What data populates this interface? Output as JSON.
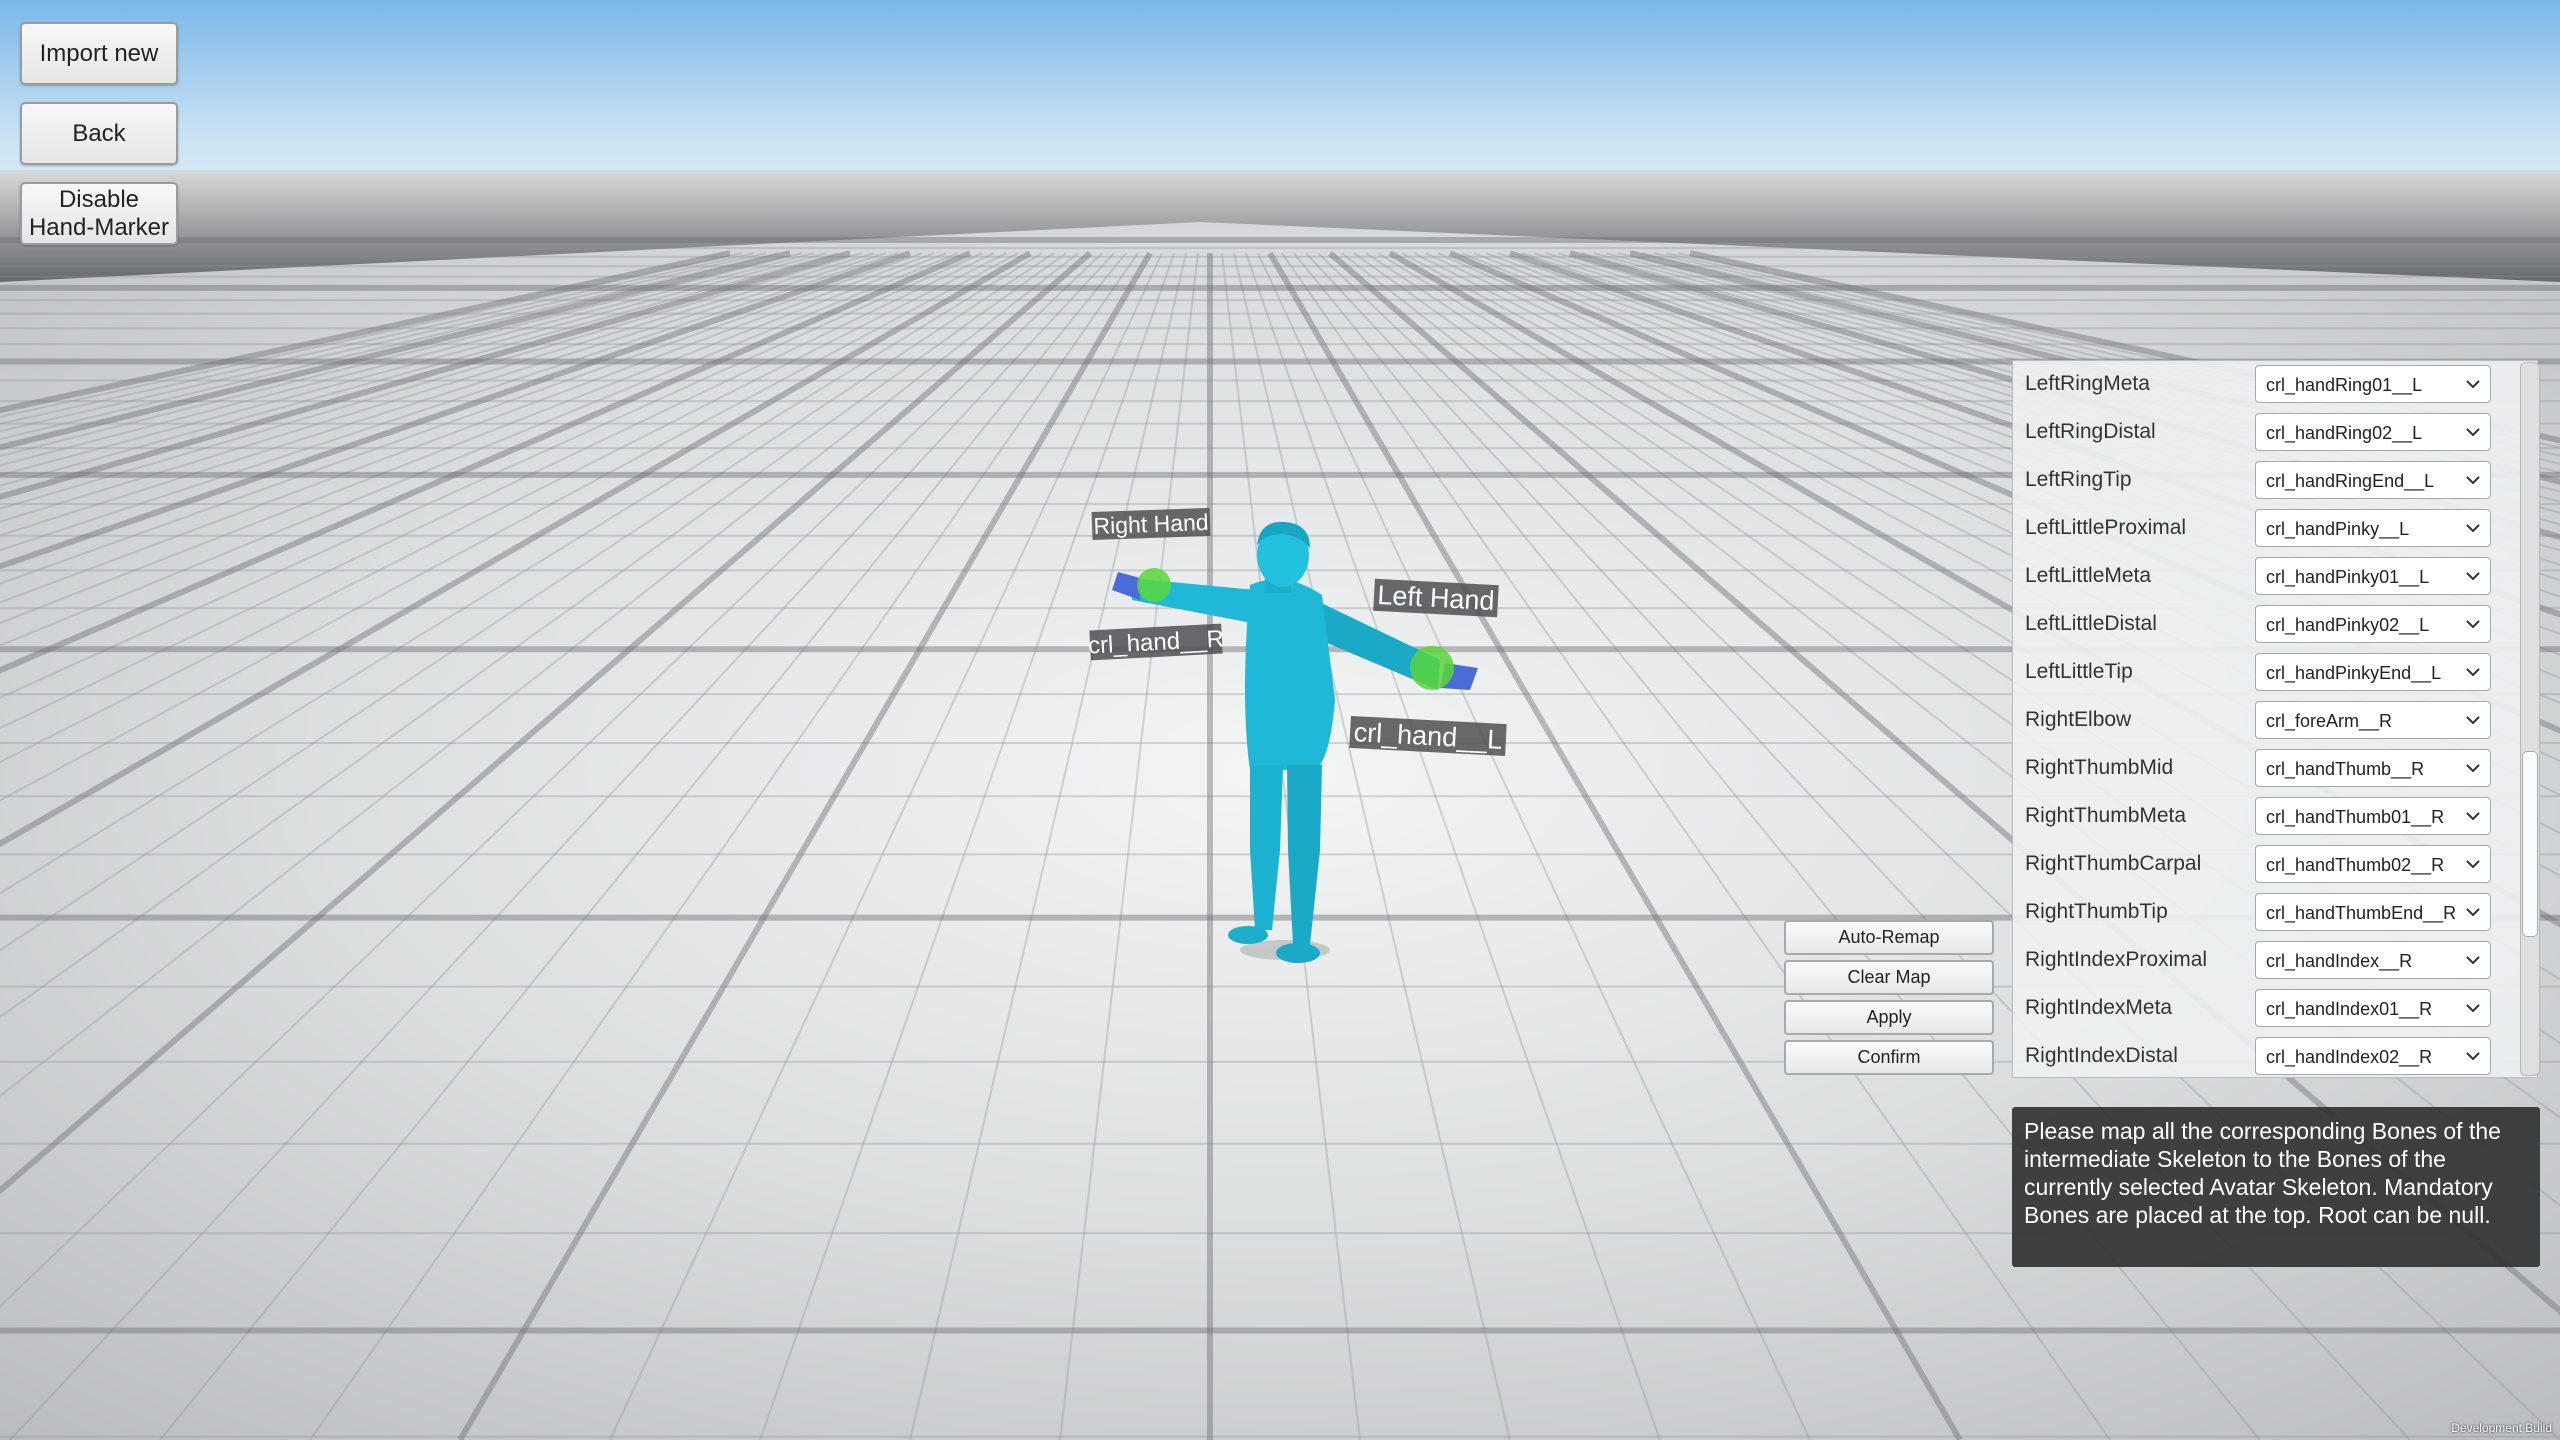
{
  "buttons": {
    "import_new": "Import new",
    "back": "Back",
    "disable_hand_marker_line1": "Disable",
    "disable_hand_marker_line2": "Hand-Marker"
  },
  "scene": {
    "right_hand_label": "Right Hand",
    "left_hand_label": "Left Hand",
    "right_bone_label": "crl_hand__R",
    "left_bone_label": "crl_hand__L",
    "model_color": "#1fb8d6",
    "marker_color": "#59d63c"
  },
  "actions": {
    "auto_remap": "Auto-Remap",
    "clear_map": "Clear Map",
    "apply": "Apply",
    "confirm": "Confirm"
  },
  "mapping": {
    "rows": [
      {
        "label": "LeftRingMeta",
        "value": "crl_handRing01__L"
      },
      {
        "label": "LeftRingDistal",
        "value": "crl_handRing02__L"
      },
      {
        "label": "LeftRingTip",
        "value": "crl_handRingEnd__L"
      },
      {
        "label": "LeftLittleProximal",
        "value": "crl_handPinky__L"
      },
      {
        "label": "LeftLittleMeta",
        "value": "crl_handPinky01__L"
      },
      {
        "label": "LeftLittleDistal",
        "value": "crl_handPinky02__L"
      },
      {
        "label": "LeftLittleTip",
        "value": "crl_handPinkyEnd__L"
      },
      {
        "label": "RightElbow",
        "value": "crl_foreArm__R"
      },
      {
        "label": "RightThumbMid",
        "value": "crl_handThumb__R"
      },
      {
        "label": "RightThumbMeta",
        "value": "crl_handThumb01__R"
      },
      {
        "label": "RightThumbCarpal",
        "value": "crl_handThumb02__R"
      },
      {
        "label": "RightThumbTip",
        "value": "crl_handThumbEnd__R"
      },
      {
        "label": "RightIndexProximal",
        "value": "crl_handIndex__R"
      },
      {
        "label": "RightIndexMeta",
        "value": "crl_handIndex01__R"
      },
      {
        "label": "RightIndexDistal",
        "value": "crl_handIndex02__R"
      }
    ]
  },
  "hint_text": "Please map all the corresponding Bones of the intermediate Skeleton to the Bones of the currently selected Avatar Skeleton. Mandatory Bones are placed at the top. Root can be null.",
  "footer": {
    "dev_build": "Development Build"
  }
}
